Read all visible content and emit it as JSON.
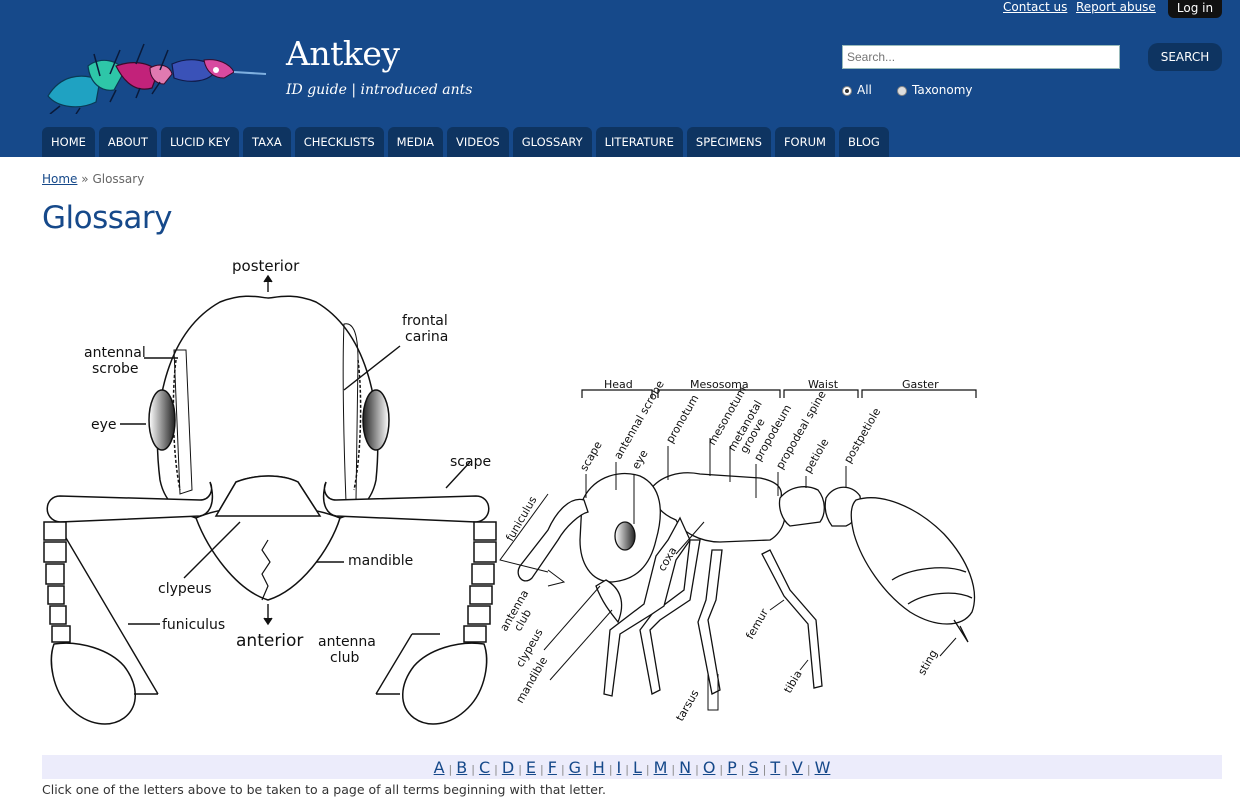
{
  "header": {
    "site_name": "Antkey",
    "slogan": "ID guide | introduced ants",
    "contact_link": "Contact us",
    "report_link": "Report abuse",
    "login_label": "Log in"
  },
  "search": {
    "placeholder": "Search...",
    "button_label": "SEARCH",
    "options": [
      {
        "label": "All",
        "selected": true
      },
      {
        "label": "Taxonomy",
        "selected": false
      }
    ]
  },
  "nav": {
    "items": [
      "HOME",
      "ABOUT",
      "LUCID KEY",
      "TAXA",
      "CHECKLISTS",
      "MEDIA",
      "VIDEOS",
      "GLOSSARY",
      "LITERATURE",
      "SPECIMENS",
      "FORUM",
      "BLOG"
    ]
  },
  "breadcrumb": {
    "home": "Home",
    "separator": "»",
    "current": "Glossary"
  },
  "page_title": "Glossary",
  "diagram": {
    "head_labels": {
      "posterior": "posterior",
      "frontal": "frontal",
      "carina": "carina",
      "antennal": "antennal",
      "scrobe": "scrobe",
      "eye": "eye",
      "scape": "scape",
      "mandible": "mandible",
      "clypeus": "clypeus",
      "funiculus": "funiculus",
      "anterior": "anterior",
      "antenna": "antenna",
      "club": "club"
    },
    "body_sections": [
      "Head",
      "Mesosoma",
      "Waist",
      "Gaster"
    ],
    "body_labels": {
      "scape": "scape",
      "antennal_scrobe": "antennal scrobe",
      "eye": "eye",
      "pronotum": "pronotum",
      "mesonotum": "mesonotum",
      "metanotal": "metanotal",
      "groove": "groove",
      "propodeum": "propodeum",
      "propodeal_spine": "propodeal spine",
      "petiole": "petiole",
      "postpetiole": "postpetiole",
      "funiculus": "funiculus",
      "coxa": "coxa",
      "antenna": "antenna",
      "club": "club",
      "clypeus": "clypeus",
      "mandible": "mandible",
      "femur": "femur",
      "tibia": "tibia",
      "tarsus": "tarsus",
      "sting": "sting"
    }
  },
  "alphabet": [
    "A",
    "B",
    "C",
    "D",
    "E",
    "F",
    "G",
    "H",
    "I",
    "L",
    "M",
    "N",
    "O",
    "P",
    "S",
    "T",
    "V",
    "W"
  ],
  "alphabet_separator": "|",
  "instruction": "Click one of the letters above to be taken to a page of all terms beginning with that letter.",
  "colors": {
    "header_bg": "#16498a",
    "nav_tab_bg": "#0e3461",
    "title_color": "#16498a",
    "alphabar_bg": "#ececfb"
  }
}
